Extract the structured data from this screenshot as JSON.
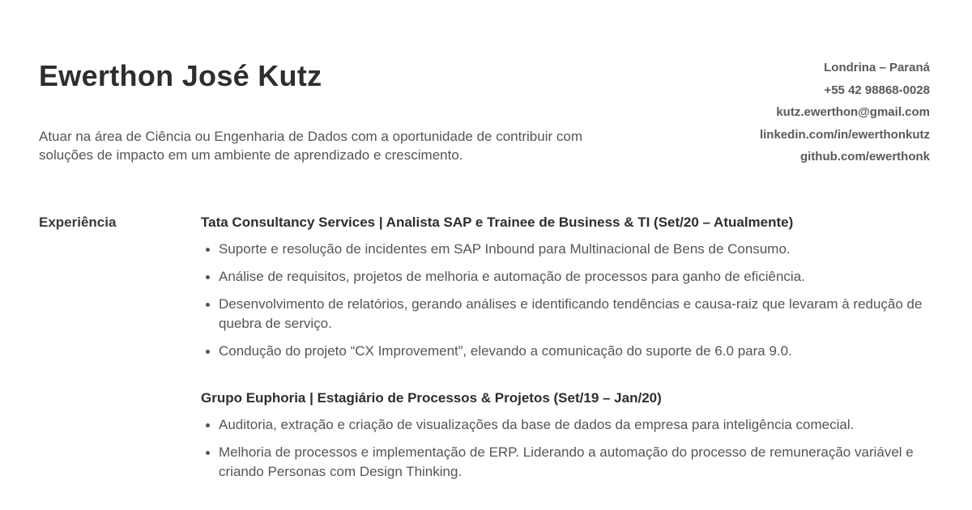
{
  "header": {
    "name": "Ewerthon José Kutz",
    "objective": "Atuar na área de Ciência ou Engenharia de Dados com a oportunidade de contribuir com soluções de impacto em um ambiente de aprendizado e crescimento."
  },
  "contact": {
    "location": "Londrina – Paraná",
    "phone": "+55 42 98868-0028",
    "email": "kutz.ewerthon@gmail.com",
    "linkedin": "linkedin.com/in/ewerthonkutz",
    "github": "github.com/ewerthonk"
  },
  "experience": {
    "label": "Experiência",
    "jobs": [
      {
        "title": "Tata Consultancy Services | Analista SAP e Trainee de Business & TI (Set/20 – Atualmente)",
        "bullets": [
          "Suporte e resolução de incidentes em SAP Inbound para Multinacional de Bens de Consumo.",
          "Análise de requisitos, projetos de melhoria e automação de processos para ganho de eficiência.",
          "Desenvolvimento de relatórios, gerando análises e identificando tendências e causa-raiz que levaram à redução de quebra de serviço.",
          "Condução do projeto “CX Improvement”, elevando a comunicação do suporte de 6.0 para 9.0."
        ]
      },
      {
        "title": "Grupo Euphoria | Estagiário de Processos & Projetos (Set/19 – Jan/20)",
        "bullets": [
          "Auditoria, extração e criação de visualizações da base de dados da empresa para inteligência comecial.",
          "Melhoria de processos e implementação de ERP. Liderando a automação do processo de remuneração variável e criando Personas com Design Thinking."
        ]
      }
    ]
  }
}
